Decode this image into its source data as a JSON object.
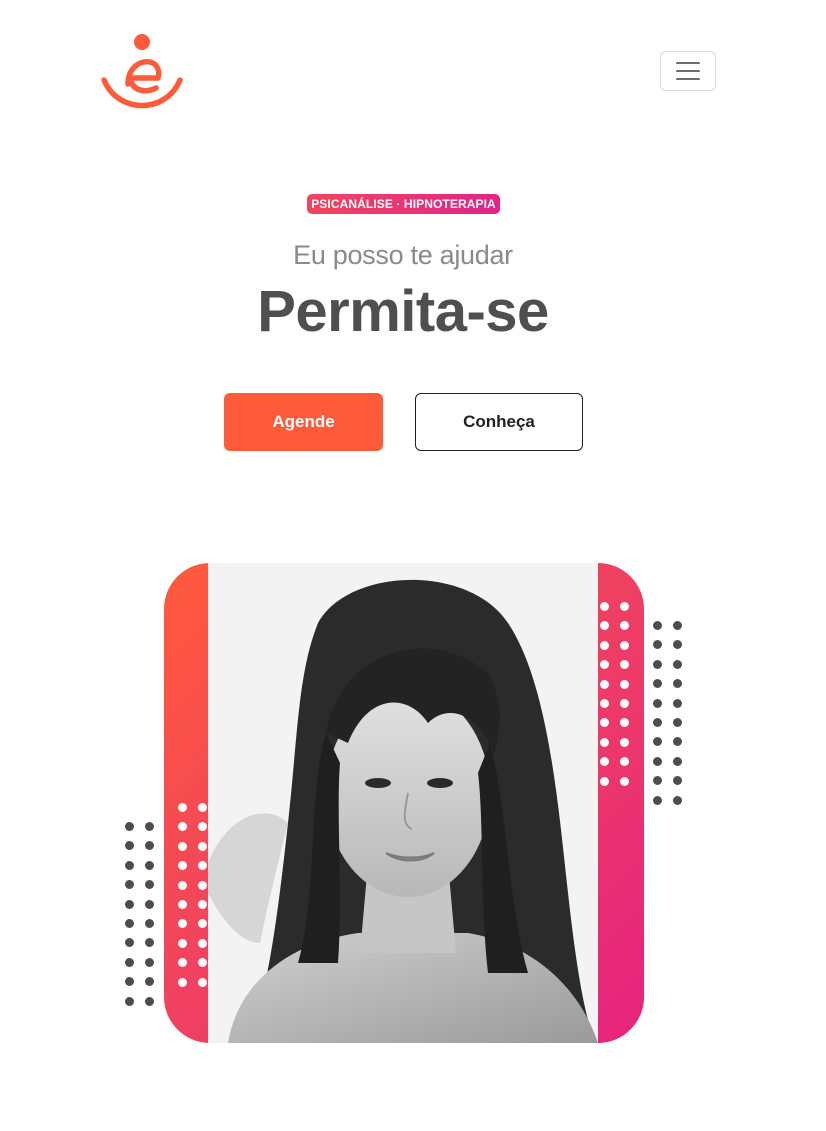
{
  "header": {
    "logo_icon": "smiling-e-logo-icon",
    "menu_icon": "hamburger-menu-icon",
    "brand_color": "#ff5a3a"
  },
  "hero": {
    "badge": "PSICANÁLISE · HIPNOTERAPIA",
    "subtitle": "Eu posso te ajudar",
    "title": "Permita-se",
    "primary_button": "Agende",
    "secondary_button": "Conheça"
  },
  "portrait": {
    "gradient_colors": [
      "#ff5a3a",
      "#e6237f"
    ]
  }
}
